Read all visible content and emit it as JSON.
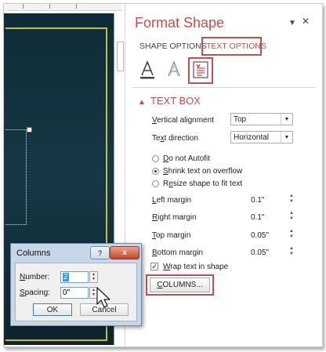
{
  "pane": {
    "title": "Format Shape",
    "tabs": {
      "shape_options": "SHAPE OPTIONS",
      "text_options": "TEXT OPTIONS"
    },
    "section_title": "TEXT BOX",
    "vertical_alignment": {
      "label_pre": "",
      "label_u": "V",
      "label_post": "ertical alignment",
      "value": "Top"
    },
    "text_direction": {
      "label_pre": "Te",
      "label_u": "x",
      "label_post": "t direction",
      "value": "Horizontal"
    },
    "autofit": [
      {
        "pre": "",
        "u": "D",
        "post": "o not Autofit",
        "selected": false
      },
      {
        "pre": "",
        "u": "S",
        "post": "hrink text on overflow",
        "selected": true
      },
      {
        "pre": "R",
        "u": "e",
        "post": "size shape to fit text",
        "selected": false
      }
    ],
    "margins": [
      {
        "pre": "",
        "u": "L",
        "post": "eft margin",
        "value": "0.1\""
      },
      {
        "pre": "",
        "u": "R",
        "post": "ight margin",
        "value": "0.1\""
      },
      {
        "pre": "",
        "u": "T",
        "post": "op margin",
        "value": "0.05\""
      },
      {
        "pre": "",
        "u": "B",
        "post": "ottom margin",
        "value": "0.05\""
      }
    ],
    "wrap": {
      "pre": "",
      "u": "W",
      "post": "rap text in shape",
      "checked": true
    },
    "columns_button": {
      "pre": "",
      "u": "C",
      "post": "OLUMNS..."
    }
  },
  "dialog": {
    "title": "Columns",
    "help": "?",
    "close": "x",
    "number": {
      "label_u": "N",
      "label_post": "umber:",
      "value": "2"
    },
    "spacing": {
      "label_u": "S",
      "label_post": "pacing:",
      "value": "0\""
    },
    "ok": "OK",
    "cancel": "Cancel"
  },
  "icons": {
    "pane_close": "close-icon",
    "pane_menu": "chevron-down-icon",
    "text_fill": "text-fill-icon",
    "text_effects": "text-effects-icon",
    "textbox": "textbox-icon"
  },
  "colors": {
    "accent": "#c0504d",
    "slide_bg": "#143442",
    "slide_border": "#c9bb3a"
  }
}
